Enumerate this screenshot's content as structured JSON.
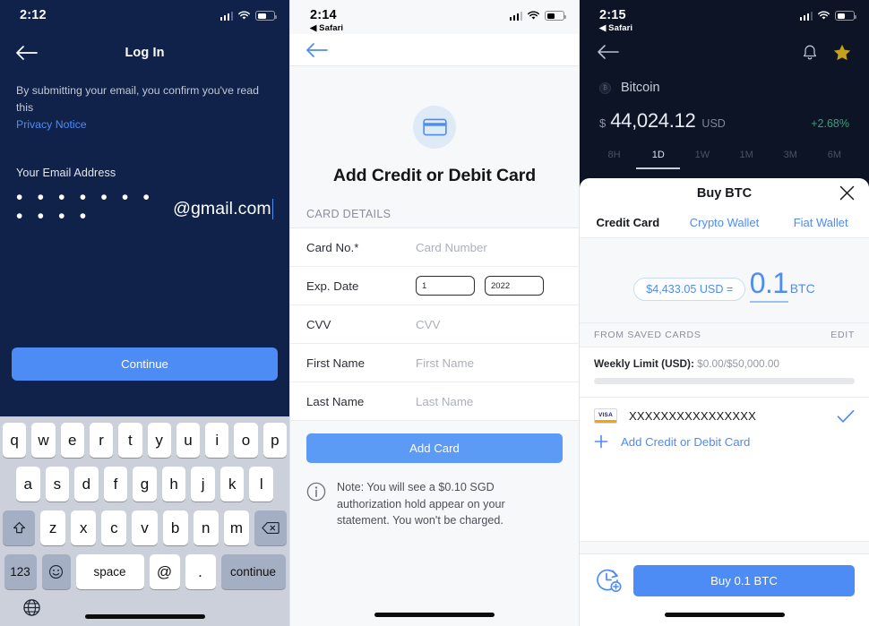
{
  "panel1": {
    "status": {
      "time": "2:12"
    },
    "nav": {
      "title": "Log In",
      "back_icon": "arrow-left-icon"
    },
    "legal": {
      "text": "By submitting your email, you confirm you've read this",
      "link": "Privacy Notice"
    },
    "email": {
      "label": "Your Email Address",
      "masked": "• • • • • • • • • • •",
      "domain": "@gmail.com"
    },
    "continue_label": "Continue",
    "keyboard": {
      "row1": [
        "q",
        "w",
        "e",
        "r",
        "t",
        "y",
        "u",
        "i",
        "o",
        "p"
      ],
      "row2": [
        "a",
        "s",
        "d",
        "f",
        "g",
        "h",
        "j",
        "k",
        "l"
      ],
      "row3": [
        "z",
        "x",
        "c",
        "v",
        "b",
        "n",
        "m"
      ],
      "shift_icon": "shift-up-icon",
      "backspace_icon": "backspace-icon",
      "numbers_label": "123",
      "emoji_icon": "emoji-smiley-icon",
      "space_label": "space",
      "at_label": "@",
      "dot_label": ".",
      "return_label": "continue",
      "globe_icon": "globe-icon"
    }
  },
  "panel2": {
    "status": {
      "time": "2:14",
      "back_app": "Safari"
    },
    "nav": {
      "back_icon": "arrow-left-icon"
    },
    "hero": {
      "icon": "credit-card-icon",
      "title": "Add Credit or Debit Card"
    },
    "section_header": "CARD DETAILS",
    "fields": [
      {
        "label": "Card No.*",
        "placeholder": "Card Number",
        "value": ""
      },
      {
        "label": "Exp. Date",
        "month": "1",
        "year": "2022"
      },
      {
        "label": "CVV",
        "placeholder": "CVV",
        "value": ""
      },
      {
        "label": "First Name",
        "placeholder": "First Name",
        "value": ""
      },
      {
        "label": "Last Name",
        "placeholder": "Last Name",
        "value": ""
      }
    ],
    "add_card_label": "Add Card",
    "note": {
      "icon": "info-circle-icon",
      "text": "Note: You will see a $0.10 SGD authorization hold appear on your statement. You won't be charged."
    }
  },
  "panel3": {
    "status": {
      "time": "2:15",
      "back_app": "Safari"
    },
    "nav": {
      "back_icon": "arrow-left-icon",
      "bell_icon": "bell-icon",
      "star_icon": "star-filled-icon"
    },
    "asset": {
      "icon": "bitcoin-icon",
      "name": "Bitcoin"
    },
    "price": {
      "currency_symbol": "$",
      "value": "44,024.12",
      "currency_code": "USD",
      "change": "+2.68%"
    },
    "ranges": [
      {
        "label": "8H",
        "selected": false
      },
      {
        "label": "1D",
        "selected": true
      },
      {
        "label": "1W",
        "selected": false
      },
      {
        "label": "1M",
        "selected": false
      },
      {
        "label": "3M",
        "selected": false
      },
      {
        "label": "6M",
        "selected": false
      }
    ],
    "sheet": {
      "title": "Buy BTC",
      "close_icon": "close-x-icon",
      "tabs": [
        {
          "label": "Credit Card",
          "selected": true
        },
        {
          "label": "Crypto Wallet",
          "selected": false
        },
        {
          "label": "Fiat Wallet",
          "selected": false
        }
      ],
      "fiat_chip": "$4,433.05 USD =",
      "amount": "0.1",
      "amount_unit": "BTC",
      "saved_header": "FROM SAVED CARDS",
      "edit_label": "EDIT",
      "limit_label": "Weekly Limit (USD):",
      "limit_value": "$0.00/$50,000.00",
      "card": {
        "brand": "VISA",
        "number": "XXXXXXXXXXXXXXXX",
        "check_icon": "check-icon"
      },
      "add_card_link": "Add Credit or Debit Card",
      "add_icon": "plus-icon",
      "recurring_icon": "recurring-clock-icon",
      "buy_button": "Buy 0.1 BTC"
    }
  },
  "colors": {
    "navy": "#10224a",
    "accent_blue": "#4d8bf5",
    "dark_bg": "#0c1425",
    "green": "#3f9e7a",
    "gold": "#c4a01c"
  }
}
